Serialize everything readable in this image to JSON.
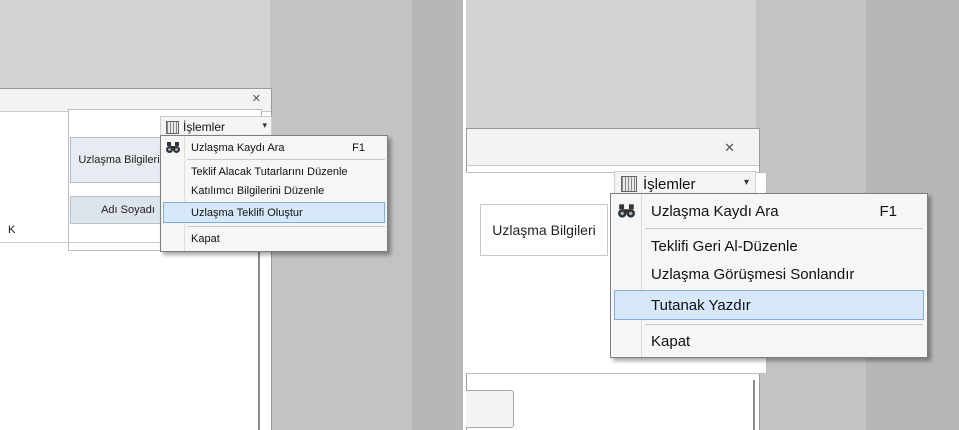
{
  "left": {
    "close_glyph": "✕",
    "tab_label": "Uzlaşma Bilgileri",
    "column_header": "Adı Soyadı",
    "cell_value": "K",
    "menu_button_label": "İşlemler",
    "menu_button_arrow": "▾",
    "menu": [
      {
        "label": "Uzlaşma Kaydı Ara",
        "shortcut": "F1",
        "icon": "binoculars-icon",
        "highlighted": false
      },
      {
        "label": "Teklif Alacak Tutarlarını Düzenle",
        "shortcut": "",
        "icon": "",
        "highlighted": false
      },
      {
        "label": "Katılımcı Bilgilerini Düzenle",
        "shortcut": "",
        "icon": "",
        "highlighted": false
      },
      {
        "label": "Uzlaşma Teklifi Oluştur",
        "shortcut": "",
        "icon": "",
        "highlighted": true
      },
      {
        "label": "Kapat",
        "shortcut": "",
        "icon": "",
        "highlighted": false
      }
    ]
  },
  "right": {
    "close_glyph": "✕",
    "tab_label": "Uzlaşma Bilgileri",
    "menu_button_label": "İşlemler",
    "menu_button_arrow": "▾",
    "menu": [
      {
        "label": "Uzlaşma Kaydı Ara",
        "shortcut": "F1",
        "icon": "binoculars-icon",
        "highlighted": false
      },
      {
        "label": "Teklifi Geri Al-Düzenle",
        "shortcut": "",
        "icon": "",
        "highlighted": false
      },
      {
        "label": "Uzlaşma Görüşmesi Sonlandır",
        "shortcut": "",
        "icon": "",
        "highlighted": false
      },
      {
        "label": "Tutanak Yazdır",
        "shortcut": "",
        "icon": "",
        "highlighted": true
      },
      {
        "label": "Kapat",
        "shortcut": "",
        "icon": "",
        "highlighted": false
      }
    ]
  }
}
